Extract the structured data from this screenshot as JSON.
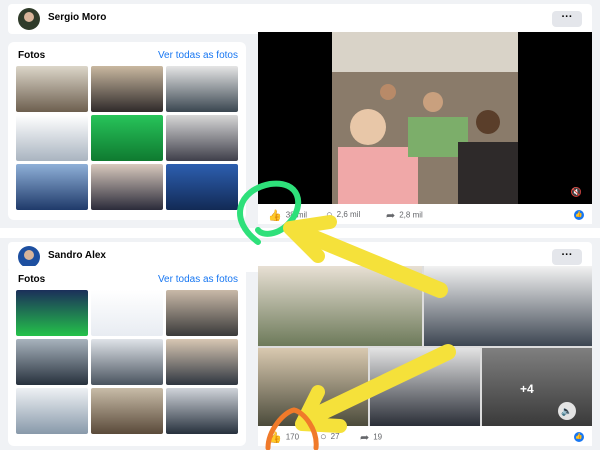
{
  "post1": {
    "page_name": "Sergio Moro",
    "more": "···",
    "photos_title": "Fotos",
    "photos_link": "Ver todas as fotos",
    "likes": "38 mil",
    "comments": "2,6 mil",
    "shares": "2,8 mil"
  },
  "post2": {
    "page_name": "Sandro Alex",
    "more": "···",
    "photos_title": "Fotos",
    "photos_link": "Ver todas as fotos",
    "likes": "170",
    "comments": "27",
    "shares": "19",
    "collage_more": "+4"
  },
  "icons": {
    "like": "like-icon",
    "comment": "comment-icon",
    "share": "share-icon",
    "sound": "speaker-icon",
    "more": "more-icon"
  },
  "colors": {
    "accent": "#1877f2",
    "annotation_green": "#2ee07a",
    "annotation_yellow": "#f5e13a",
    "annotation_orange": "#f07a2a"
  }
}
